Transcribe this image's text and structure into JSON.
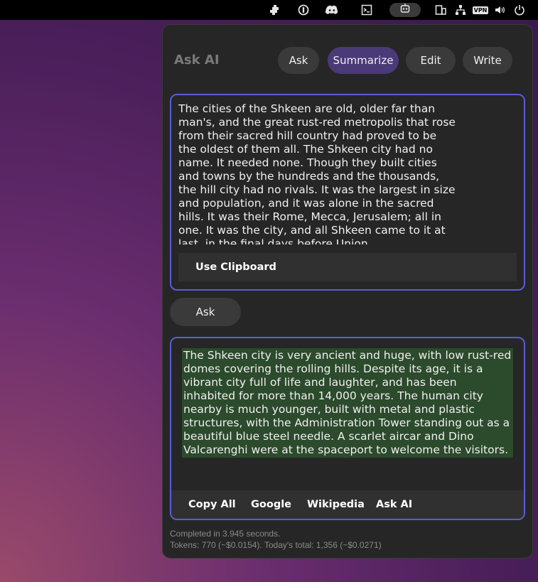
{
  "topbar": {
    "icons": [
      "puzzle-icon",
      "onepassword-icon",
      "discord-icon",
      "screenshot-icon",
      "robot-icon",
      "display-icon",
      "network-icon",
      "vpn-icon",
      "volume-icon",
      "power-icon"
    ],
    "vpn_label": "VPN"
  },
  "panel": {
    "title": "Ask AI",
    "modes": [
      {
        "label": "Ask"
      },
      {
        "label": "Summarize"
      },
      {
        "label": "Edit"
      },
      {
        "label": "Write"
      }
    ],
    "active_mode": "Summarize",
    "input_text": "The cities of the Shkeen are old, older far than\nman's, and the great rust-red metropolis that rose\nfrom their sacred hill country had proved to be\nthe oldest of them all. The Shkeen city had no\nname. It needed none. Though they built cities\nand towns by the hundreds and the thousands,\nthe hill city had no rivals. It was the largest in size\nand population, and it was alone in the sacred\nhills. It was their Rome, Mecca, Jerusalem; all in\none. It was the city, and all Shkeen came to it at\nlast, in the final days before Union.",
    "use_clipboard_label": "Use Clipboard",
    "ask_button_label": "Ask",
    "output_text": "The Shkeen city is very ancient and huge, with low rust-red domes covering the rolling hills. Despite its age, it is a vibrant city full of life and laughter, and has been inhabited for more than 14,000 years. The human city nearby is much younger, built with metal and plastic structures, with the Administration Tower standing out as a beautiful blue steel needle. A scarlet aircar and Dino Valcarenghi were at the spaceport to welcome the visitors.",
    "actions": {
      "copy_all": "Copy All",
      "google": "Google",
      "wikipedia": "Wikipedia",
      "ask_ai": "Ask AI"
    },
    "status_completed": "Completed in 3.945 seconds.",
    "status_tokens": "Tokens: 770 (~$0.0154). Today's total: 1,356 (~$0.0271)"
  },
  "colors": {
    "accent_border": "#5b5bd6",
    "active_mode_bg": "#4a3a78",
    "selection_bg": "#2c4a2c"
  }
}
